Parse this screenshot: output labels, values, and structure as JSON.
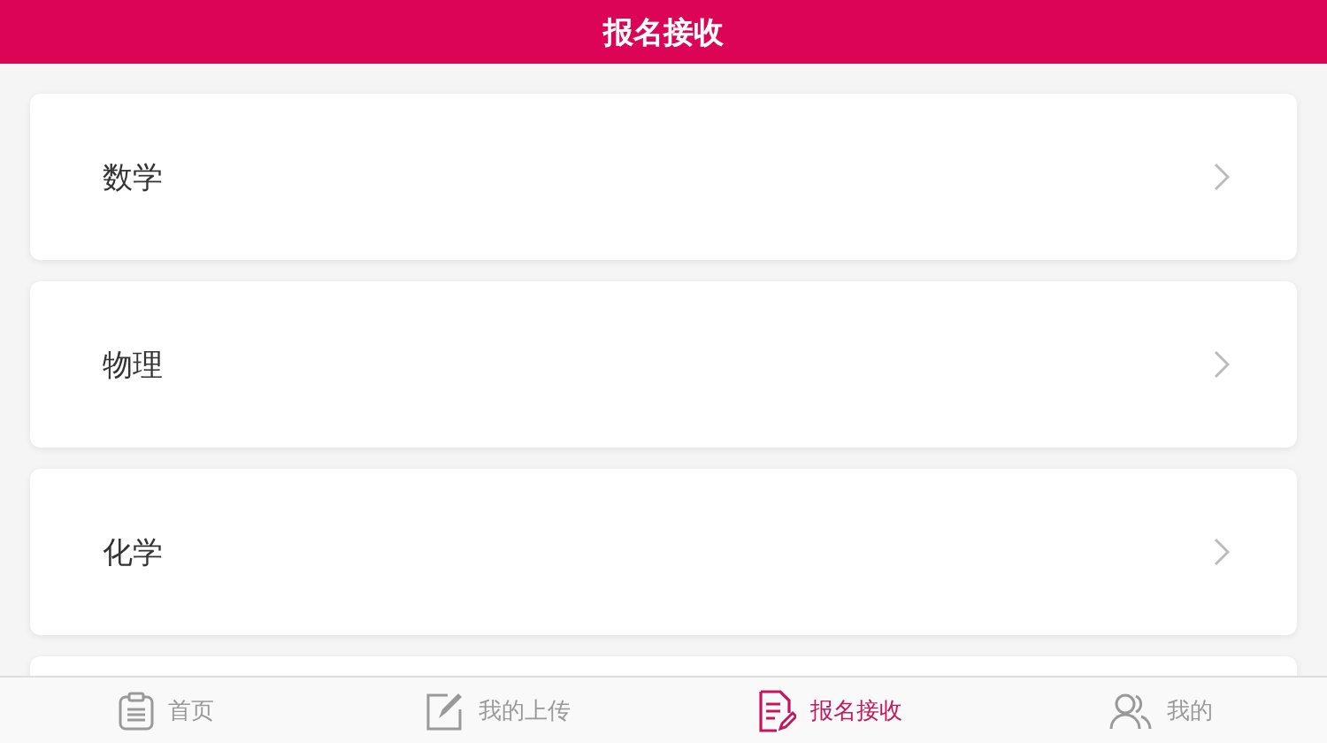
{
  "header": {
    "title": "报名接收"
  },
  "subjects": [
    {
      "name": "数学"
    },
    {
      "name": "物理"
    },
    {
      "name": "化学"
    }
  ],
  "tabs": [
    {
      "label": "首页",
      "kind": "clipboard",
      "selected": false
    },
    {
      "label": "我的上传",
      "kind": "edit",
      "selected": false
    },
    {
      "label": "报名接收",
      "kind": "document",
      "selected": true
    },
    {
      "label": "我的",
      "kind": "users",
      "selected": false
    }
  ]
}
